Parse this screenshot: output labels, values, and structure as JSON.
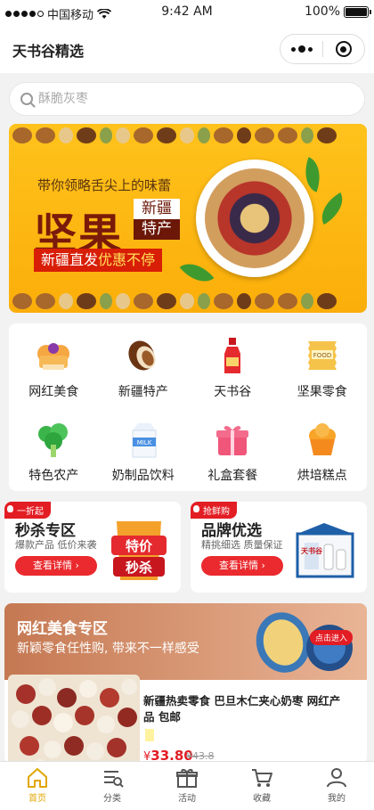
{
  "status_bar": {
    "carrier": "中国移动",
    "time": "9:42 AM",
    "battery": "100%"
  },
  "nav": {
    "title": "天书谷精选",
    "more_icon": "more-dots-icon",
    "close_icon": "record-close-icon"
  },
  "search": {
    "placeholder": "酥脆灰枣",
    "icon": "search-icon"
  },
  "banner": {
    "slogan": "带你领略舌尖上的味蕾",
    "headline": "坚果",
    "tag_line1": "新疆",
    "tag_line2": "特产",
    "strip_text": "新疆直发",
    "strip_highlight": "优惠不停"
  },
  "categories": [
    {
      "label": "网红美食",
      "icon": "cake-icon"
    },
    {
      "label": "新疆特产",
      "icon": "nut-icon"
    },
    {
      "label": "天书谷",
      "icon": "bottle-icon"
    },
    {
      "label": "坚果零食",
      "icon": "snack-bag-icon"
    },
    {
      "label": "特色农产",
      "icon": "vegetable-icon"
    },
    {
      "label": "奶制品饮料",
      "icon": "milk-carton-icon"
    },
    {
      "label": "礼盒套餐",
      "icon": "gift-box-icon"
    },
    {
      "label": "烘培糕点",
      "icon": "cupcake-icon"
    }
  ],
  "promos": [
    {
      "badge": "一折起",
      "title": "秒杀专区",
      "subtitle": "爆款产品  低价来袭",
      "button": "查看详情",
      "art_line1": "特价",
      "art_line2": "秒杀"
    },
    {
      "badge": "抢鲜购",
      "title": "品牌优选",
      "subtitle": "精挑细选  质量保证",
      "button": "查看详情",
      "art_text": "天书谷"
    }
  ],
  "featured": {
    "title": "网红美食专区",
    "subtitle": "新颖零食任性购, 带来不一样感受",
    "enter_label": "点击进入",
    "product": {
      "name": "新疆热卖零食 巴旦木仁夹心奶枣 网红产品 包邮",
      "price_symbol": "¥",
      "price": "33.80",
      "original_price": "¥43.8"
    }
  },
  "tabbar": [
    {
      "label": "首页",
      "icon": "home-icon",
      "active": true
    },
    {
      "label": "分类",
      "icon": "category-list-icon",
      "active": false
    },
    {
      "label": "活动",
      "icon": "gift-activity-icon",
      "active": false
    },
    {
      "label": "收藏",
      "icon": "cart-icon",
      "active": false
    },
    {
      "label": "我的",
      "icon": "user-icon",
      "active": false
    }
  ],
  "colors": {
    "accent": "#e31d24",
    "brand_yellow": "#ffc21c",
    "tab_active": "#e0a600"
  }
}
